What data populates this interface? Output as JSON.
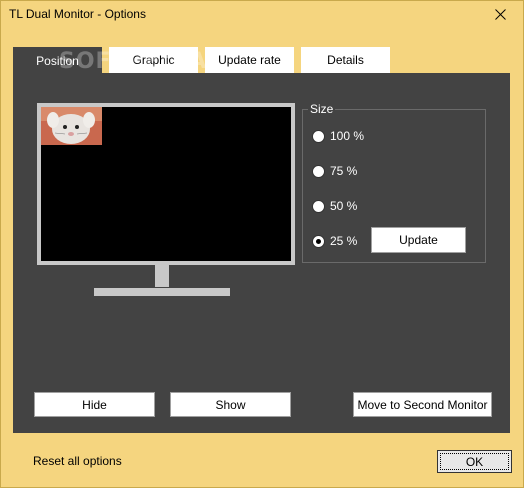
{
  "window": {
    "title": "TL Dual Monitor - Options",
    "close_icon": "close-icon"
  },
  "watermark": "SOFTPEDIA",
  "tabs": [
    {
      "label": "Position",
      "active": true
    },
    {
      "label": "Graphic",
      "active": false
    },
    {
      "label": "Update rate",
      "active": false
    },
    {
      "label": "Details",
      "active": false
    }
  ],
  "size": {
    "legend": "Size",
    "options": [
      {
        "label": "100 %",
        "selected": false
      },
      {
        "label": "75 %",
        "selected": false
      },
      {
        "label": "50 %",
        "selected": false
      },
      {
        "label": "25 %",
        "selected": true
      }
    ],
    "update_label": "Update"
  },
  "actions": {
    "hide_label": "Hide",
    "show_label": "Show",
    "move_label": "Move to Second Monitor"
  },
  "footer": {
    "reset_label": "Reset all options",
    "ok_label": "OK"
  },
  "colors": {
    "window_bg": "#f5d57f",
    "panel_bg": "#434343",
    "monitor_frame": "#c8c8c8",
    "screen": "#000000"
  }
}
